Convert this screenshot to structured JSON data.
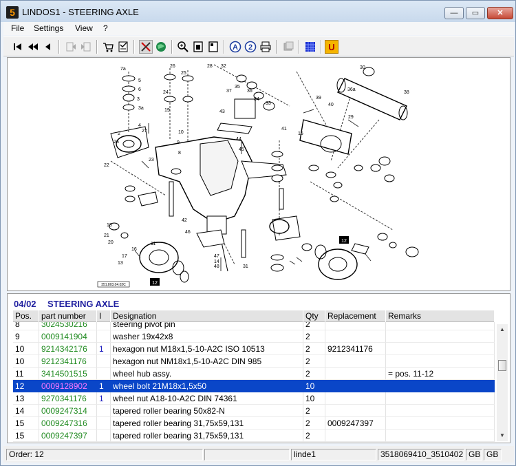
{
  "window": {
    "app_icon_label": "5",
    "title": "LINDOS1 - STEERING AXLE",
    "minimize_glyph": "—",
    "maximize_glyph": "▭",
    "close_glyph": "✕"
  },
  "menu": [
    "File",
    "Settings",
    "View",
    "?"
  ],
  "toolbar": {
    "icons": [
      "first-page-icon",
      "previous-fast-icon",
      "previous-icon",
      "back-icon",
      "forward-icon",
      "cart-icon",
      "checklist-icon",
      "tools-icon",
      "globe-icon",
      "zoom-icon",
      "fit-page-icon",
      "page-icon",
      "a-circle-icon",
      "2-circle-icon",
      "print-icon",
      "disabled-icon",
      "blue-grid-icon",
      "u-icon"
    ],
    "u_label": "U",
    "a_label": "A",
    "two_label": "2"
  },
  "drawing": {
    "drawing_number": "351.803.04.02C",
    "callout_12_a": "12",
    "callout_12_b": "12",
    "part_numbers": [
      "7a",
      "5",
      "6",
      "3",
      "3a",
      "2",
      "2a",
      "4",
      "27",
      "22",
      "23",
      "18",
      "21",
      "20",
      "17",
      "13",
      "16",
      "26",
      "25",
      "24",
      "19",
      "11",
      "10",
      "9",
      "8",
      "32",
      "28",
      "37",
      "35",
      "36",
      "34",
      "33",
      "43",
      "44",
      "45",
      "46",
      "47",
      "48",
      "14",
      "42",
      "31",
      "30",
      "36a",
      "38",
      "39",
      "40",
      "41",
      "29",
      "15"
    ]
  },
  "parts": {
    "group_code": "04/02",
    "group_title": "STEERING AXLE",
    "columns": [
      "Pos.",
      "part number",
      "I",
      "Designation",
      "Qty",
      "Replacement",
      "Remarks"
    ],
    "rows": [
      {
        "pos": "8",
        "pn": "3024530216",
        "i": "",
        "des": "steering pivot pin",
        "qty": "2",
        "rep": "",
        "rem": ""
      },
      {
        "pos": "9",
        "pn": "0009141904",
        "i": "",
        "des": "washer 19x42x8",
        "qty": "2",
        "rep": "",
        "rem": ""
      },
      {
        "pos": "10",
        "pn": "9214342176",
        "i": "1",
        "des": "hexagon nut M18x1,5-10-A2C  ISO 10513",
        "qty": "2",
        "rep": "9212341176",
        "rem": ""
      },
      {
        "pos": "10",
        "pn": "9212341176",
        "i": "",
        "des": "hexagon nut NM18x1,5-10-A2C  DIN 985",
        "qty": "2",
        "rep": "",
        "rem": ""
      },
      {
        "pos": "11",
        "pn": "3414501515",
        "i": "",
        "des": "wheel hub assy.",
        "qty": "2",
        "rep": "",
        "rem": "= pos. 11-12"
      },
      {
        "pos": "12",
        "pn": "0009128902",
        "i": "1",
        "des": "wheel bolt 21M18x1,5x50",
        "qty": "10",
        "rep": "",
        "rem": ""
      },
      {
        "pos": "13",
        "pn": "9270341176",
        "i": "1",
        "des": "wheel nut A18-10-A2C  DIN 74361",
        "qty": "10",
        "rep": "",
        "rem": ""
      },
      {
        "pos": "14",
        "pn": "0009247314",
        "i": "",
        "des": "tapered roller bearing 50x82-N",
        "qty": "2",
        "rep": "",
        "rem": ""
      },
      {
        "pos": "15",
        "pn": "0009247316",
        "i": "",
        "des": "tapered roller bearing 31,75x59,131",
        "qty": "2",
        "rep": "0009247397",
        "rem": ""
      },
      {
        "pos": "15",
        "pn": "0009247397",
        "i": "",
        "des": "tapered roller bearing 31,75x59,131",
        "qty": "2",
        "rep": "",
        "rem": ""
      }
    ],
    "selected_index": 5
  },
  "status": {
    "order": "Order: 12",
    "empty1": "",
    "empty2": "",
    "user": "linde1",
    "code": "3518069410_3510402",
    "lang1": "GB",
    "lang2": "GB"
  }
}
